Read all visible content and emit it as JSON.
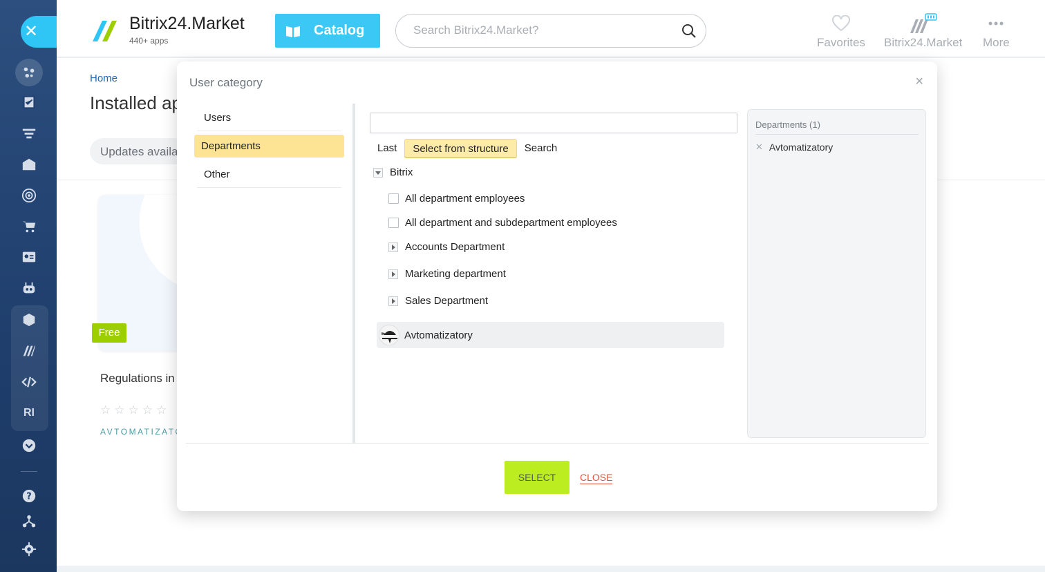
{
  "header": {
    "logo_title": "Bitrix24.Market",
    "logo_subtitle": "440+ apps",
    "catalog_label": "Catalog",
    "search_placeholder": "Search Bitrix24.Market?",
    "favorites_label": "Favorites",
    "market_label": "Bitrix24.Market",
    "more_label": "More",
    "accent_color": "#3bc8f5"
  },
  "sidebar": {
    "close_icon": "close-icon",
    "items": [
      "activity-icon",
      "tasks-icon",
      "crm-filter-icon",
      "store-icon",
      "target-icon",
      "cart-icon",
      "contact-card-icon",
      "robot-icon",
      "box-icon",
      "market-icon",
      "code-icon",
      "RI",
      "chevron-down-icon",
      "help-icon",
      "structure-icon",
      "settings-icon"
    ]
  },
  "page": {
    "breadcrumb_home": "Home",
    "title": "Installed ap",
    "updates_label": "Updates availa",
    "card": {
      "badge": "Free",
      "name": "Regulations in",
      "rating_stars": "☆☆☆☆☆",
      "vendor": "AVTOMATIZATO"
    }
  },
  "modal": {
    "title": "User category",
    "close_glyph": "×",
    "categories": [
      {
        "label": "Users",
        "active": false
      },
      {
        "label": "Departments",
        "active": true
      },
      {
        "label": "Other",
        "active": false
      }
    ],
    "filter_value": "",
    "tabs": [
      {
        "label": "Last",
        "active": false
      },
      {
        "label": "Select from structure",
        "active": true
      },
      {
        "label": "Search",
        "active": false
      }
    ],
    "tree": {
      "root": "Bitrix",
      "all_employees": "All department employees",
      "all_sub_employees": "All department and subdepartment employees",
      "departments": [
        "Accounts Department",
        "Marketing department",
        "Sales Department"
      ],
      "selected": "Avtomatizatory"
    },
    "selected_panel": {
      "heading": "Departments (1)",
      "items": [
        "Avtomatizatory"
      ],
      "remove_glyph": "✕"
    },
    "select_label": "SELECT",
    "close_label": "CLOSE",
    "select_color": "#bbed21",
    "close_color": "#e0533e",
    "highlight_color": "#fde495"
  }
}
